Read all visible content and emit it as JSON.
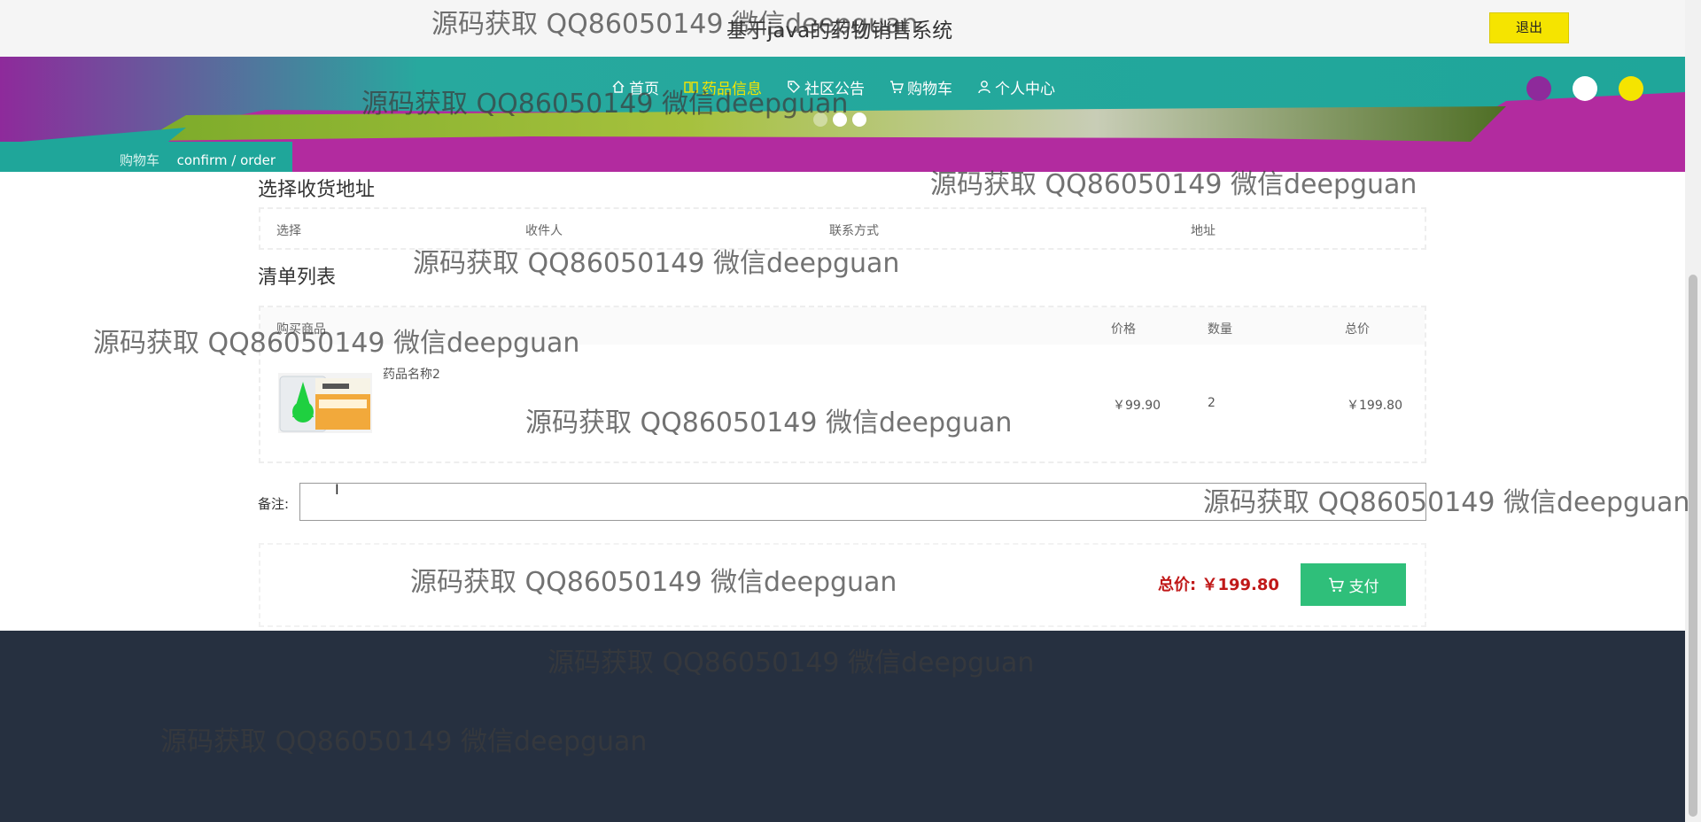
{
  "header": {
    "title": "基于java的药物销售系统",
    "logout_label": "退出"
  },
  "nav": {
    "items": [
      {
        "label": "首页",
        "icon": "home-icon"
      },
      {
        "label": "药品信息",
        "icon": "book-icon",
        "active": true
      },
      {
        "label": "社区公告",
        "icon": "tag-icon"
      },
      {
        "label": "购物车",
        "icon": "cart-icon"
      },
      {
        "label": "个人中心",
        "icon": "user-icon"
      }
    ]
  },
  "theme_swatches": [
    "#8e2a9b",
    "#ffffff",
    "#f5e400"
  ],
  "carousel": {
    "dot_count": 3
  },
  "breadcrumb": {
    "current": "购物车",
    "path": "confirm / order"
  },
  "address": {
    "title": "选择收货地址",
    "columns": [
      "选择",
      "收件人",
      "联系方式",
      "地址"
    ]
  },
  "order_list": {
    "title": "清单列表",
    "columns": [
      "购买商品",
      "价格",
      "数量",
      "总价"
    ],
    "items": [
      {
        "name": "药品名称2",
        "price": "￥99.90",
        "quantity": "2",
        "subtotal": "￥199.80"
      }
    ]
  },
  "remark": {
    "label": "备注:",
    "value": ""
  },
  "payment": {
    "total_label": "总价:",
    "total_value": "￥199.80",
    "pay_label": "支付"
  },
  "watermark": {
    "text": "源码获取 QQ86050149 微信deepguan"
  },
  "colors": {
    "accent_teal": "#27a99e",
    "accent_purple": "#b22b9f",
    "highlight_yellow": "#f5e400",
    "pay_green": "#2fbf7a",
    "total_red": "#c01818",
    "footer_bg": "#263040"
  }
}
